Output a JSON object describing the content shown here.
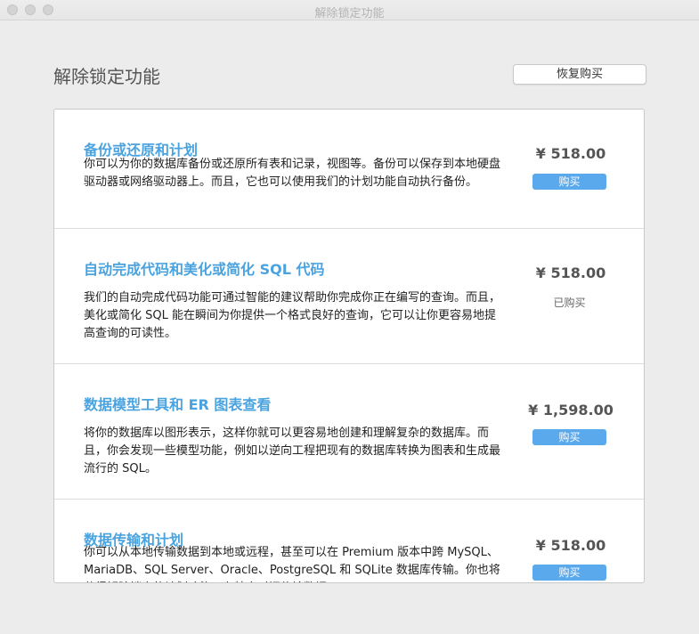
{
  "window": {
    "title": "解除锁定功能"
  },
  "header": {
    "title": "解除锁定功能",
    "restore_label": "恢复购买"
  },
  "items": [
    {
      "title": "备份或还原和计划",
      "description": "你可以为你的数据库备份或还原所有表和记录，视图等。备份可以保存到本地硬盘驱动器或网络驱动器上。而且，它也可以使用我们的计划功能自动执行备份。",
      "price": "¥ 518.00",
      "action": "购买"
    },
    {
      "title": "自动完成代码和美化或简化 SQL 代码",
      "description": "我们的自动完成代码功能可通过智能的建议帮助你完成你正在编写的查询。而且，美化或简化 SQL  能在瞬间为你提供一个格式良好的查询，它可以让你更容易地提高查询的可读性。",
      "price": "¥ 518.00",
      "status": "已购买"
    },
    {
      "title": "数据模型工具和 ER 图表查看",
      "description": "将你的数据库以图形表示，这样你就可以更容易地创建和理解复杂的数据库。而且，你会发现一些模型功能，例如以逆向工程把现有的数据库转换为图表和生成最流行的 SQL。",
      "price": "¥ 1,598.00",
      "action": "购买"
    },
    {
      "title": "数据传输和计划",
      "description": "你可以从本地传输数据到本地或远程，甚至可以在 Premium 版本中跨 MySQL、MariaDB、SQL Server、Oracle、PostgreSQL 和 SQLite 数据库传输。你也将获得解除锁定的计划功能，在特定时间传输数据。",
      "price": "¥ 518.00",
      "action": "购买"
    }
  ]
}
